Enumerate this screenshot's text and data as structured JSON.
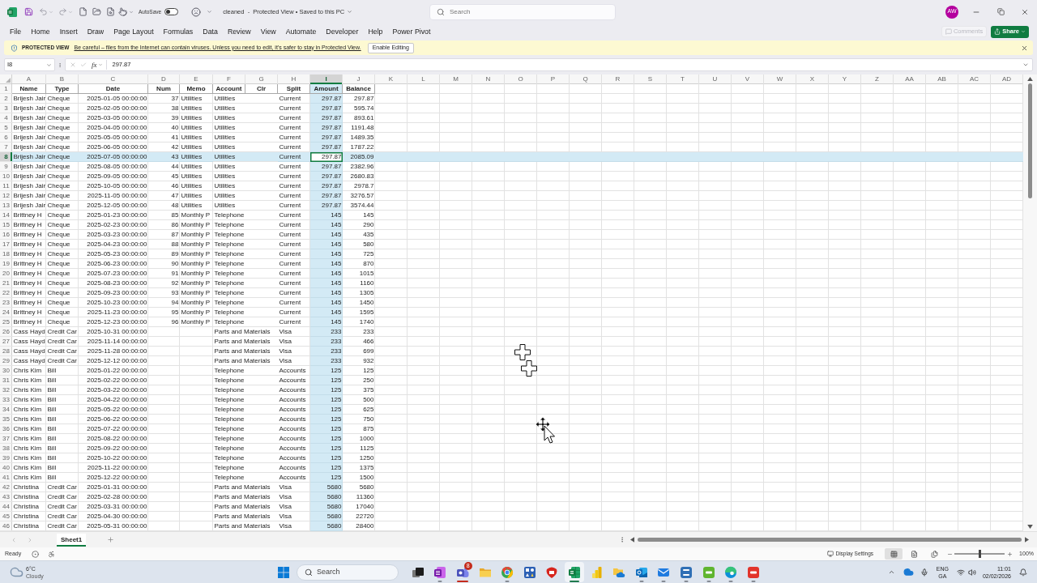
{
  "title_bar": {
    "autosave_label": "AutoSave",
    "autosave_on": false,
    "document_title": "cleaned  -  Protected View • Saved to this PC",
    "search_placeholder": "Search",
    "avatar_initials": "AW"
  },
  "ribbon": {
    "tabs": [
      "File",
      "Home",
      "Insert",
      "Draw",
      "Page Layout",
      "Formulas",
      "Data",
      "Review",
      "View",
      "Automate",
      "Developer",
      "Help",
      "Power Pivot"
    ],
    "comments": {
      "label": "Comments",
      "disabled": true
    },
    "share": {
      "label": "Share"
    }
  },
  "protected_view": {
    "title": "PROTECTED VIEW",
    "message": "Be careful – files from the Internet can contain viruses. Unless you need to edit, it's safer to stay in Protected View.",
    "button": "Enable Editing"
  },
  "formula_bar": {
    "name_box": "I8",
    "function_symbol": "fx",
    "formula": "297.87"
  },
  "sheet": {
    "columns": [
      {
        "label": "A",
        "selected": false
      },
      {
        "label": "B",
        "selected": false
      },
      {
        "label": "C",
        "selected": false
      },
      {
        "label": "D",
        "selected": false
      },
      {
        "label": "E",
        "selected": false
      },
      {
        "label": "F",
        "selected": false
      },
      {
        "label": "G",
        "selected": false
      },
      {
        "label": "H",
        "selected": false
      },
      {
        "label": "I",
        "selected": true
      },
      {
        "label": "J",
        "selected": false
      },
      {
        "label": "K",
        "selected": false
      },
      {
        "label": "L",
        "selected": false
      },
      {
        "label": "M",
        "selected": false
      },
      {
        "label": "N",
        "selected": false
      },
      {
        "label": "O",
        "selected": false
      },
      {
        "label": "P",
        "selected": false
      },
      {
        "label": "Q",
        "selected": false
      },
      {
        "label": "R",
        "selected": false
      },
      {
        "label": "S",
        "selected": false
      },
      {
        "label": "T",
        "selected": false
      },
      {
        "label": "U",
        "selected": false
      },
      {
        "label": "V",
        "selected": false
      },
      {
        "label": "W",
        "selected": false
      },
      {
        "label": "X",
        "selected": false
      },
      {
        "label": "Y",
        "selected": false
      },
      {
        "label": "Z",
        "selected": false
      },
      {
        "label": "AA",
        "selected": false
      },
      {
        "label": "AB",
        "selected": false
      },
      {
        "label": "AC",
        "selected": false
      },
      {
        "label": "AD",
        "selected": false
      }
    ],
    "header_row": {
      "number": "1",
      "cells": [
        "Name",
        "Type",
        "Date",
        "Num",
        "Memo",
        "Account",
        "Clr",
        "Split",
        "Amount",
        "Balance"
      ]
    },
    "rows": [
      {
        "number": "2",
        "selected": false,
        "cells": [
          "Brijesh Jair",
          "Cheque",
          "2025-01-05 00:00:00",
          "37",
          "Utilities",
          "Utilities",
          null,
          "Current",
          "297.87",
          "297.87"
        ]
      },
      {
        "number": "3",
        "selected": false,
        "cells": [
          "Brijesh Jair",
          "Cheque",
          "2025-02-05 00:00:00",
          "38",
          "Utilities",
          "Utilities",
          null,
          "Current",
          "297.87",
          "595.74"
        ]
      },
      {
        "number": "4",
        "selected": false,
        "cells": [
          "Brijesh Jair",
          "Cheque",
          "2025-03-05 00:00:00",
          "39",
          "Utilities",
          "Utilities",
          null,
          "Current",
          "297.87",
          "893.61"
        ]
      },
      {
        "number": "5",
        "selected": false,
        "cells": [
          "Brijesh Jair",
          "Cheque",
          "2025-04-05 00:00:00",
          "40",
          "Utilities",
          "Utilities",
          null,
          "Current",
          "297.87",
          "1191.48"
        ]
      },
      {
        "number": "6",
        "selected": false,
        "cells": [
          "Brijesh Jair",
          "Cheque",
          "2025-05-05 00:00:00",
          "41",
          "Utilities",
          "Utilities",
          null,
          "Current",
          "297.87",
          "1489.35"
        ]
      },
      {
        "number": "7",
        "selected": false,
        "cells": [
          "Brijesh Jair",
          "Cheque",
          "2025-06-05 00:00:00",
          "42",
          "Utilities",
          "Utilities",
          null,
          "Current",
          "297.87",
          "1787.22"
        ]
      },
      {
        "number": "8",
        "selected": true,
        "cells": [
          "Brijesh Jair",
          "Cheque",
          "2025-07-05 00:00:00",
          "43",
          "Utilities",
          "Utilities",
          null,
          "Current",
          "297.87",
          "2085.09"
        ]
      },
      {
        "number": "9",
        "selected": false,
        "cells": [
          "Brijesh Jair",
          "Cheque",
          "2025-08-05 00:00:00",
          "44",
          "Utilities",
          "Utilities",
          null,
          "Current",
          "297.87",
          "2382.96"
        ]
      },
      {
        "number": "10",
        "selected": false,
        "cells": [
          "Brijesh Jair",
          "Cheque",
          "2025-09-05 00:00:00",
          "45",
          "Utilities",
          "Utilities",
          null,
          "Current",
          "297.87",
          "2680.83"
        ]
      },
      {
        "number": "11",
        "selected": false,
        "cells": [
          "Brijesh Jair",
          "Cheque",
          "2025-10-05 00:00:00",
          "46",
          "Utilities",
          "Utilities",
          null,
          "Current",
          "297.87",
          "2978.7"
        ]
      },
      {
        "number": "12",
        "selected": false,
        "cells": [
          "Brijesh Jair",
          "Cheque",
          "2025-11-05 00:00:00",
          "47",
          "Utilities",
          "Utilities",
          null,
          "Current",
          "297.87",
          "3276.57"
        ]
      },
      {
        "number": "13",
        "selected": false,
        "cells": [
          "Brijesh Jair",
          "Cheque",
          "2025-12-05 00:00:00",
          "48",
          "Utilities",
          "Utilities",
          null,
          "Current",
          "297.87",
          "3574.44"
        ]
      },
      {
        "number": "14",
        "selected": false,
        "cells": [
          "Brittney H",
          "Cheque",
          "2025-01-23 00:00:00",
          "85",
          "Monthly P",
          "Telephone",
          null,
          "Current",
          "145",
          "145"
        ]
      },
      {
        "number": "15",
        "selected": false,
        "cells": [
          "Brittney H",
          "Cheque",
          "2025-02-23 00:00:00",
          "86",
          "Monthly P",
          "Telephone",
          null,
          "Current",
          "145",
          "290"
        ]
      },
      {
        "number": "16",
        "selected": false,
        "cells": [
          "Brittney H",
          "Cheque",
          "2025-03-23 00:00:00",
          "87",
          "Monthly P",
          "Telephone",
          null,
          "Current",
          "145",
          "435"
        ]
      },
      {
        "number": "17",
        "selected": false,
        "cells": [
          "Brittney H",
          "Cheque",
          "2025-04-23 00:00:00",
          "88",
          "Monthly P",
          "Telephone",
          null,
          "Current",
          "145",
          "580"
        ]
      },
      {
        "number": "18",
        "selected": false,
        "cells": [
          "Brittney H",
          "Cheque",
          "2025-05-23 00:00:00",
          "89",
          "Monthly P",
          "Telephone",
          null,
          "Current",
          "145",
          "725"
        ]
      },
      {
        "number": "19",
        "selected": false,
        "cells": [
          "Brittney H",
          "Cheque",
          "2025-06-23 00:00:00",
          "90",
          "Monthly P",
          "Telephone",
          null,
          "Current",
          "145",
          "870"
        ]
      },
      {
        "number": "20",
        "selected": false,
        "cells": [
          "Brittney H",
          "Cheque",
          "2025-07-23 00:00:00",
          "91",
          "Monthly P",
          "Telephone",
          null,
          "Current",
          "145",
          "1015"
        ]
      },
      {
        "number": "21",
        "selected": false,
        "cells": [
          "Brittney H",
          "Cheque",
          "2025-08-23 00:00:00",
          "92",
          "Monthly P",
          "Telephone",
          null,
          "Current",
          "145",
          "1160"
        ]
      },
      {
        "number": "22",
        "selected": false,
        "cells": [
          "Brittney H",
          "Cheque",
          "2025-09-23 00:00:00",
          "93",
          "Monthly P",
          "Telephone",
          null,
          "Current",
          "145",
          "1305"
        ]
      },
      {
        "number": "23",
        "selected": false,
        "cells": [
          "Brittney H",
          "Cheque",
          "2025-10-23 00:00:00",
          "94",
          "Monthly P",
          "Telephone",
          null,
          "Current",
          "145",
          "1450"
        ]
      },
      {
        "number": "24",
        "selected": false,
        "cells": [
          "Brittney H",
          "Cheque",
          "2025-11-23 00:00:00",
          "95",
          "Monthly P",
          "Telephone",
          null,
          "Current",
          "145",
          "1595"
        ]
      },
      {
        "number": "25",
        "selected": false,
        "cells": [
          "Brittney H",
          "Cheque",
          "2025-12-23 00:00:00",
          "96",
          "Monthly P",
          "Telephone",
          null,
          "Current",
          "145",
          "1740"
        ]
      },
      {
        "number": "26",
        "selected": false,
        "cells": [
          "Cass Hayd",
          "Credit Car",
          "2025-10-31 00:00:00",
          null,
          null,
          "Parts and Materials",
          null,
          "Visa",
          "233",
          "233"
        ]
      },
      {
        "number": "27",
        "selected": false,
        "cells": [
          "Cass Hayd",
          "Credit Car",
          "2025-11-14 00:00:00",
          null,
          null,
          "Parts and Materials",
          null,
          "Visa",
          "233",
          "466"
        ]
      },
      {
        "number": "28",
        "selected": false,
        "cells": [
          "Cass Hayd",
          "Credit Car",
          "2025-11-28 00:00:00",
          null,
          null,
          "Parts and Materials",
          null,
          "Visa",
          "233",
          "699"
        ]
      },
      {
        "number": "29",
        "selected": false,
        "cells": [
          "Cass Hayd",
          "Credit Car",
          "2025-12-12 00:00:00",
          null,
          null,
          "Parts and Materials",
          null,
          "Visa",
          "233",
          "932"
        ]
      },
      {
        "number": "30",
        "selected": false,
        "cells": [
          "Chris Kim",
          "Bill",
          "2025-01-22 00:00:00",
          null,
          null,
          "Telephone",
          null,
          "Accounts",
          "125",
          "125"
        ]
      },
      {
        "number": "31",
        "selected": false,
        "cells": [
          "Chris Kim",
          "Bill",
          "2025-02-22 00:00:00",
          null,
          null,
          "Telephone",
          null,
          "Accounts",
          "125",
          "250"
        ]
      },
      {
        "number": "32",
        "selected": false,
        "cells": [
          "Chris Kim",
          "Bill",
          "2025-03-22 00:00:00",
          null,
          null,
          "Telephone",
          null,
          "Accounts",
          "125",
          "375"
        ]
      },
      {
        "number": "33",
        "selected": false,
        "cells": [
          "Chris Kim",
          "Bill",
          "2025-04-22 00:00:00",
          null,
          null,
          "Telephone",
          null,
          "Accounts",
          "125",
          "500"
        ]
      },
      {
        "number": "34",
        "selected": false,
        "cells": [
          "Chris Kim",
          "Bill",
          "2025-05-22 00:00:00",
          null,
          null,
          "Telephone",
          null,
          "Accounts",
          "125",
          "625"
        ]
      },
      {
        "number": "35",
        "selected": false,
        "cells": [
          "Chris Kim",
          "Bill",
          "2025-06-22 00:00:00",
          null,
          null,
          "Telephone",
          null,
          "Accounts",
          "125",
          "750"
        ]
      },
      {
        "number": "36",
        "selected": false,
        "cells": [
          "Chris Kim",
          "Bill",
          "2025-07-22 00:00:00",
          null,
          null,
          "Telephone",
          null,
          "Accounts",
          "125",
          "875"
        ]
      },
      {
        "number": "37",
        "selected": false,
        "cells": [
          "Chris Kim",
          "Bill",
          "2025-08-22 00:00:00",
          null,
          null,
          "Telephone",
          null,
          "Accounts",
          "125",
          "1000"
        ]
      },
      {
        "number": "38",
        "selected": false,
        "cells": [
          "Chris Kim",
          "Bill",
          "2025-09-22 00:00:00",
          null,
          null,
          "Telephone",
          null,
          "Accounts",
          "125",
          "1125"
        ]
      },
      {
        "number": "39",
        "selected": false,
        "cells": [
          "Chris Kim",
          "Bill",
          "2025-10-22 00:00:00",
          null,
          null,
          "Telephone",
          null,
          "Accounts",
          "125",
          "1250"
        ]
      },
      {
        "number": "40",
        "selected": false,
        "cells": [
          "Chris Kim",
          "Bill",
          "2025-11-22 00:00:00",
          null,
          null,
          "Telephone",
          null,
          "Accounts",
          "125",
          "1375"
        ]
      },
      {
        "number": "41",
        "selected": false,
        "cells": [
          "Chris Kim",
          "Bill",
          "2025-12-22 00:00:00",
          null,
          null,
          "Telephone",
          null,
          "Accounts",
          "125",
          "1500"
        ]
      },
      {
        "number": "42",
        "selected": false,
        "cells": [
          "Christina",
          "Credit Car",
          "2025-01-31 00:00:00",
          null,
          null,
          "Parts and Materials",
          null,
          "Visa",
          "5680",
          "5680"
        ]
      },
      {
        "number": "43",
        "selected": false,
        "cells": [
          "Christina",
          "Credit Car",
          "2025-02-28 00:00:00",
          null,
          null,
          "Parts and Materials",
          null,
          "Visa",
          "5680",
          "11360"
        ]
      },
      {
        "number": "44",
        "selected": false,
        "cells": [
          "Christina",
          "Credit Car",
          "2025-03-31 00:00:00",
          null,
          null,
          "Parts and Materials",
          null,
          "Visa",
          "5680",
          "17040"
        ]
      },
      {
        "number": "45",
        "selected": false,
        "cells": [
          "Christina",
          "Credit Car",
          "2025-04-30 00:00:00",
          null,
          null,
          "Parts and Materials",
          null,
          "Visa",
          "5680",
          "22720"
        ]
      },
      {
        "number": "46",
        "selected": false,
        "cells": [
          "Christina",
          "Credit Car",
          "2025-05-31 00:00:00",
          null,
          null,
          "Parts and Materials",
          null,
          "Visa",
          "5680",
          "28400"
        ]
      }
    ]
  },
  "sheet_tabs": [
    {
      "label": "Sheet1",
      "selected": true
    }
  ],
  "status_bar": {
    "status": "Ready",
    "display_settings": "Display Settings",
    "views": [
      {
        "kind": "normal",
        "selected": true
      },
      {
        "kind": "page_layout",
        "selected": false
      },
      {
        "kind": "page_break",
        "selected": false
      }
    ],
    "zoom": {
      "level": 0.5,
      "label": "100%"
    }
  },
  "taskbar": {
    "weather": {
      "temperature": "6°C",
      "condition": "Cloudy"
    },
    "search_placeholder": "Search",
    "apps": [
      {
        "kind": "task_view",
        "running": false,
        "focused": false,
        "attention": false
      },
      {
        "kind": "onenote",
        "running": true,
        "focused": false,
        "attention": false
      },
      {
        "kind": "teams",
        "running": true,
        "focused": false,
        "attention": true,
        "badge": "8"
      },
      {
        "kind": "file_explorer",
        "running": false,
        "focused": false,
        "attention": false
      },
      {
        "kind": "chrome",
        "running": true,
        "focused": false,
        "attention": false
      },
      {
        "kind": "toolbox",
        "running": false,
        "focused": false,
        "attention": false
      },
      {
        "kind": "acrobat",
        "running": false,
        "focused": false,
        "attention": false
      },
      {
        "kind": "excel",
        "running": true,
        "focused": true,
        "attention": false
      },
      {
        "kind": "powerbi",
        "running": false,
        "focused": false,
        "attention": false
      },
      {
        "kind": "cloud_folder",
        "running": false,
        "focused": false,
        "attention": false
      },
      {
        "kind": "outlook",
        "running": true,
        "focused": false,
        "attention": false
      },
      {
        "kind": "outlook_new",
        "running": true,
        "focused": false,
        "attention": false
      },
      {
        "kind": "s_app",
        "running": true,
        "focused": false,
        "attention": false
      },
      {
        "kind": "c_green",
        "running": true,
        "focused": false,
        "attention": false
      },
      {
        "kind": "edge",
        "running": true,
        "focused": false,
        "attention": false
      },
      {
        "kind": "c_red",
        "running": true,
        "focused": false,
        "attention": false
      }
    ],
    "language": "ENG",
    "keyboard": "GA",
    "time": "11:01",
    "date": "02/02/2026"
  }
}
